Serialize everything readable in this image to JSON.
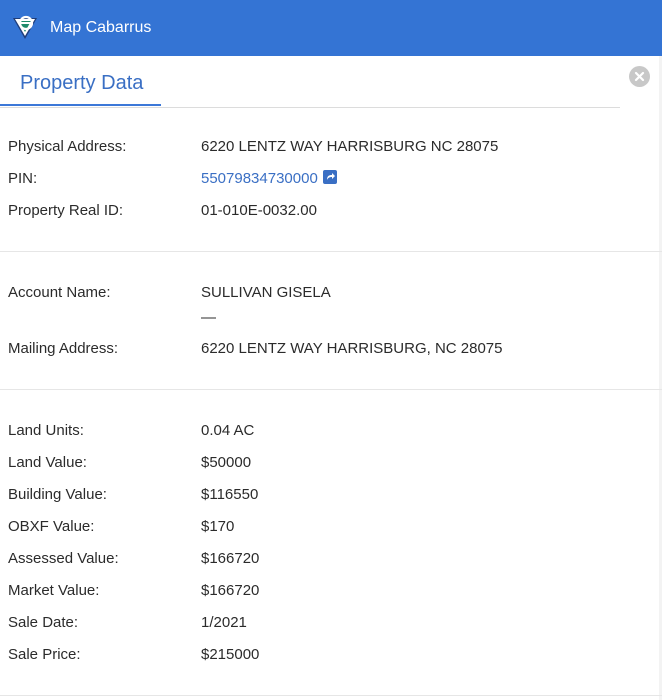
{
  "app": {
    "title": "Map Cabarrus"
  },
  "tab": {
    "label": "Property Data"
  },
  "section1": {
    "physical_address_label": "Physical Address:",
    "physical_address_value": "6220 LENTZ WAY HARRISBURG NC 28075",
    "pin_label": "PIN:",
    "pin_value": "55079834730000",
    "real_id_label": "Property Real ID:",
    "real_id_value": "01-010E-0032.00"
  },
  "section2": {
    "account_name_label": "Account Name:",
    "account_name_value": "SULLIVAN GISELA",
    "account_name_secondary": "—",
    "mailing_address_label": "Mailing Address:",
    "mailing_address_value": "6220 LENTZ WAY HARRISBURG, NC 28075"
  },
  "section3": {
    "rows": [
      {
        "label": "Land Units:",
        "value": "0.04 AC"
      },
      {
        "label": "Land Value:",
        "value": "$50000"
      },
      {
        "label": "Building Value:",
        "value": "$116550"
      },
      {
        "label": "OBXF Value:",
        "value": "$170"
      },
      {
        "label": "Assessed Value:",
        "value": "$166720"
      },
      {
        "label": "Market Value:",
        "value": "$166720"
      },
      {
        "label": "Sale Date:",
        "value": "1/2021"
      },
      {
        "label": "Sale Price:",
        "value": "$215000"
      }
    ]
  },
  "icons": {
    "logo": "map-cabarrus-logo-icon",
    "close": "close-icon",
    "external_link": "external-link-icon"
  },
  "colors": {
    "header": "#3474d4",
    "accent": "#3a6fc4",
    "close_button": "#c8c8c8"
  }
}
